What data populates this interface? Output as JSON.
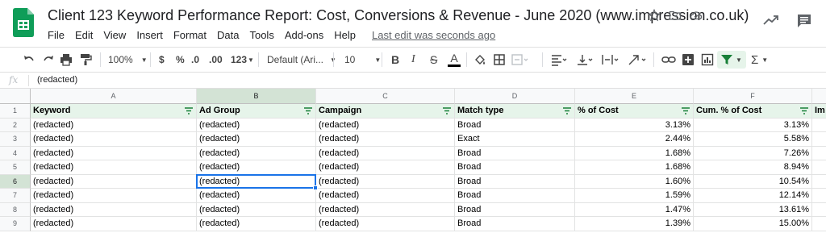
{
  "window": {
    "title": "Client 123 Keyword Performance Report: Cost, Conversions & Revenue - June 2020 (www.impression.co.uk)"
  },
  "menu": {
    "items": [
      "File",
      "Edit",
      "View",
      "Insert",
      "Format",
      "Data",
      "Tools",
      "Add-ons",
      "Help"
    ],
    "last_edit": "Last edit was seconds ago"
  },
  "toolbar": {
    "zoom": "100%",
    "currency": "$",
    "percent": "%",
    "decimal_less": ".0",
    "decimal_more": ".00",
    "more_formats": "123",
    "font": "Default (Ari...",
    "font_size": "10",
    "bold": "B",
    "italic": "I",
    "strike": "S",
    "text_color": "A",
    "sigma": "Σ"
  },
  "formula_bar": {
    "fx_label": "fx",
    "value": "(redacted)"
  },
  "grid": {
    "columns": [
      "A",
      "B",
      "C",
      "D",
      "E",
      "F"
    ],
    "selected_column": "B",
    "selected_row": "6",
    "headers": [
      "Keyword",
      "Ad Group",
      "Campaign",
      "Match type",
      "% of Cost",
      "Cum. % of Cost"
    ],
    "overflow_header": "Im",
    "rows": [
      {
        "num": "1"
      },
      {
        "num": "2",
        "keyword": "(redacted)",
        "ad_group": "(redacted)",
        "campaign": "(redacted)",
        "match": "Broad",
        "cost": "3.13%",
        "cum": "3.13%"
      },
      {
        "num": "3",
        "keyword": "(redacted)",
        "ad_group": "(redacted)",
        "campaign": "(redacted)",
        "match": "Exact",
        "cost": "2.44%",
        "cum": "5.58%"
      },
      {
        "num": "4",
        "keyword": "(redacted)",
        "ad_group": "(redacted)",
        "campaign": "(redacted)",
        "match": "Broad",
        "cost": "1.68%",
        "cum": "7.26%"
      },
      {
        "num": "5",
        "keyword": "(redacted)",
        "ad_group": "(redacted)",
        "campaign": "(redacted)",
        "match": "Broad",
        "cost": "1.68%",
        "cum": "8.94%"
      },
      {
        "num": "6",
        "keyword": "(redacted)",
        "ad_group": "(redacted)",
        "campaign": "(redacted)",
        "match": "Broad",
        "cost": "1.60%",
        "cum": "10.54%"
      },
      {
        "num": "7",
        "keyword": "(redacted)",
        "ad_group": "(redacted)",
        "campaign": "(redacted)",
        "match": "Broad",
        "cost": "1.59%",
        "cum": "12.14%"
      },
      {
        "num": "8",
        "keyword": "(redacted)",
        "ad_group": "(redacted)",
        "campaign": "(redacted)",
        "match": "Broad",
        "cost": "1.47%",
        "cum": "13.61%"
      },
      {
        "num": "9",
        "keyword": "(redacted)",
        "ad_group": "(redacted)",
        "campaign": "(redacted)",
        "match": "Broad",
        "cost": "1.39%",
        "cum": "15.00%"
      }
    ]
  },
  "colors": {
    "sheets_green": "#0f9d58",
    "selection_blue": "#1a73e8",
    "header_fill": "#e6f4ea",
    "filter_green": "#188038"
  }
}
